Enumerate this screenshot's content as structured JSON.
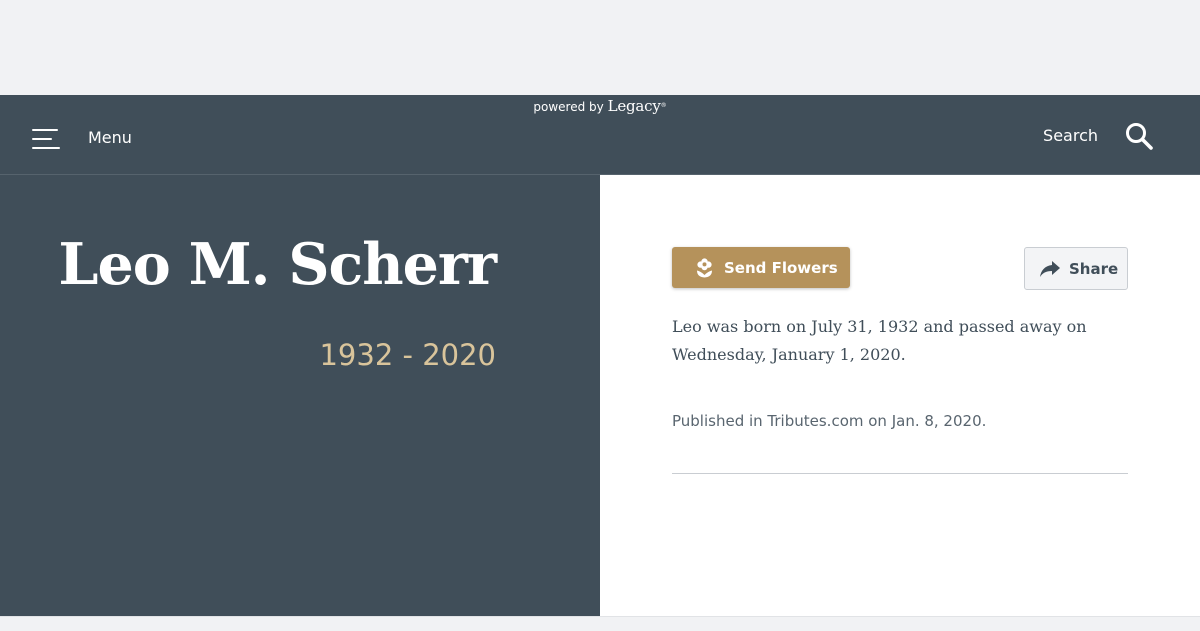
{
  "header": {
    "powered_by": "powered by",
    "brand": "Legacy",
    "trademark": "®",
    "menu_label": "Menu",
    "search_label": "Search",
    "background_color": "#404e59"
  },
  "hero": {
    "name": "Leo M. Scherr",
    "dates": "1932 - 2020",
    "dates_color": "#d9c49b"
  },
  "actions": {
    "send_flowers_label": "Send Flowers",
    "send_flowers_icon": "flower-icon",
    "send_flowers_color": "#b5925b",
    "share_label": "Share",
    "share_icon": "share-arrow-icon"
  },
  "obituary": {
    "text": "Leo was born on July 31, 1932 and passed away on Wednesday, January 1, 2020.",
    "published": "Published in Tributes.com on Jan. 8, 2020."
  }
}
